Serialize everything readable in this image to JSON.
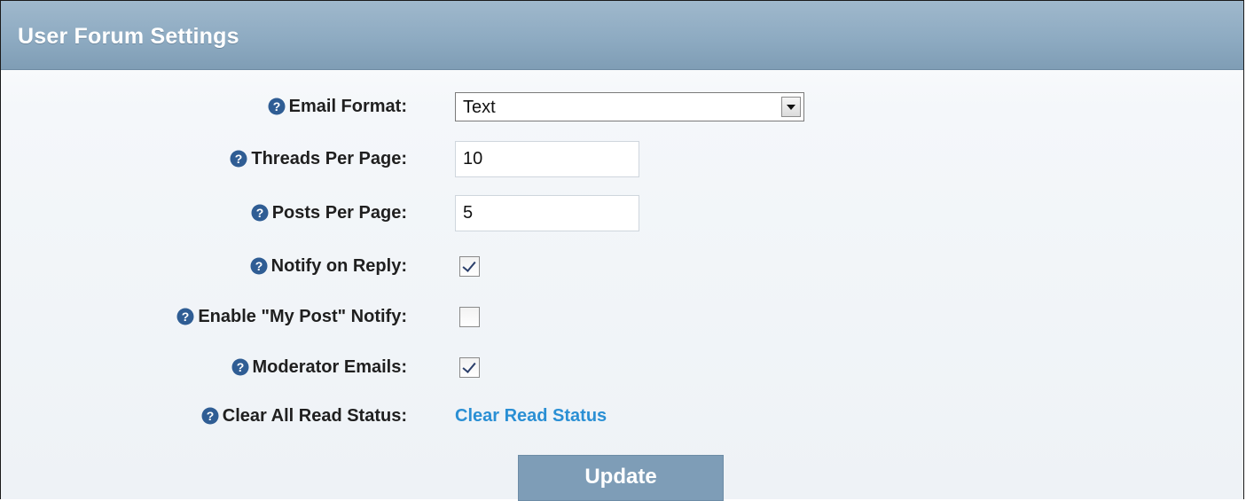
{
  "header": {
    "title": "User Forum Settings"
  },
  "fields": {
    "email_format": {
      "label": "Email Format:",
      "value": "Text"
    },
    "threads_per_page": {
      "label": "Threads Per Page:",
      "value": "10"
    },
    "posts_per_page": {
      "label": "Posts Per Page:",
      "value": "5"
    },
    "notify_on_reply": {
      "label": "Notify on Reply:",
      "checked": true
    },
    "my_post_notify": {
      "label": "Enable \"My Post\" Notify:",
      "checked": false
    },
    "moderator_emails": {
      "label": "Moderator Emails:",
      "checked": true
    },
    "clear_read_status": {
      "label": "Clear All Read Status:",
      "link_text": "Clear Read Status"
    }
  },
  "update_button": {
    "label": "Update"
  },
  "colors": {
    "header": "#8eabc2",
    "link": "#2a8fd4",
    "button": "#7e9db7",
    "help_icon": "#2f5d94"
  },
  "icons": {
    "help": "question-circle-icon"
  }
}
